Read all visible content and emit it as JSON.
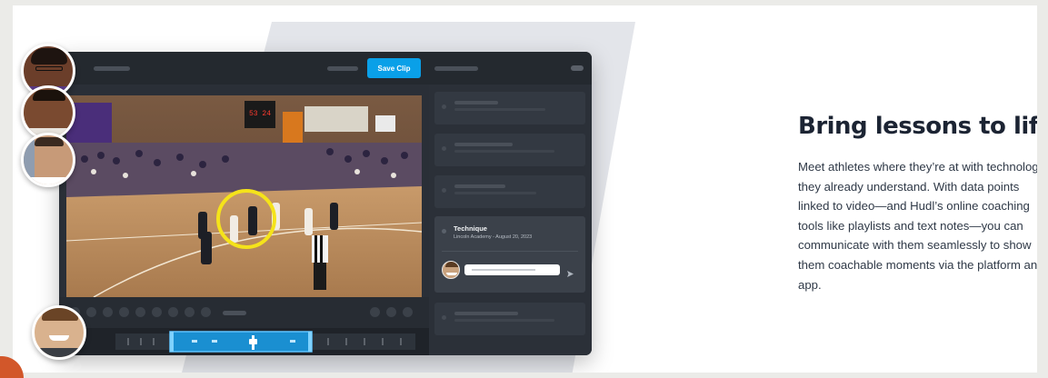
{
  "toolbar": {
    "save_label": "Save Clip"
  },
  "note": {
    "title": "Technique",
    "meta": "Lincoln Academy - August 20, 2023"
  },
  "marketing": {
    "headline": "Bring lessons to life.",
    "body": "Meet athletes where they’re at with technology they already understand. With data points linked to video—and Hudl’s online coaching tools like playlists and text notes—you can communicate with them seamlessly to show them coachable moments via the platform and app."
  },
  "scoreboard": {
    "display": "53 24"
  },
  "icons": [
    "send-icon",
    "play-icon",
    "playhead-icon",
    "highlight-circle-icon"
  ],
  "colors": {
    "accent": "#0aa0e8",
    "highlight": "#f5e31a",
    "brand_orange": "#d2572a"
  }
}
